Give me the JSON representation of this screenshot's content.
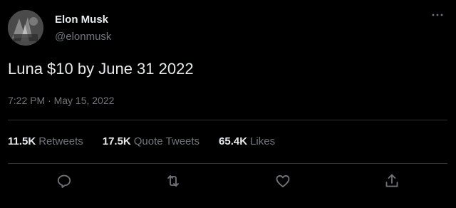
{
  "author": {
    "display_name": "Elon Musk",
    "handle": "@elonmusk"
  },
  "tweet": {
    "text": "Luna $10 by June 31 2022",
    "timestamp": "7:22 PM · May 15, 2022"
  },
  "stats": {
    "retweets": {
      "count": "11.5K",
      "label": "Retweets"
    },
    "quote_tweets": {
      "count": "17.5K",
      "label": "Quote Tweets"
    },
    "likes": {
      "count": "65.4K",
      "label": "Likes"
    }
  },
  "icons": {
    "more": "more-icon",
    "reply": "reply-icon",
    "retweet": "retweet-icon",
    "like": "like-icon",
    "share": "share-icon"
  },
  "colors": {
    "background": "#000000",
    "primary_text": "#e7e9ea",
    "secondary_text": "#71767b",
    "divider": "#2f3336"
  }
}
